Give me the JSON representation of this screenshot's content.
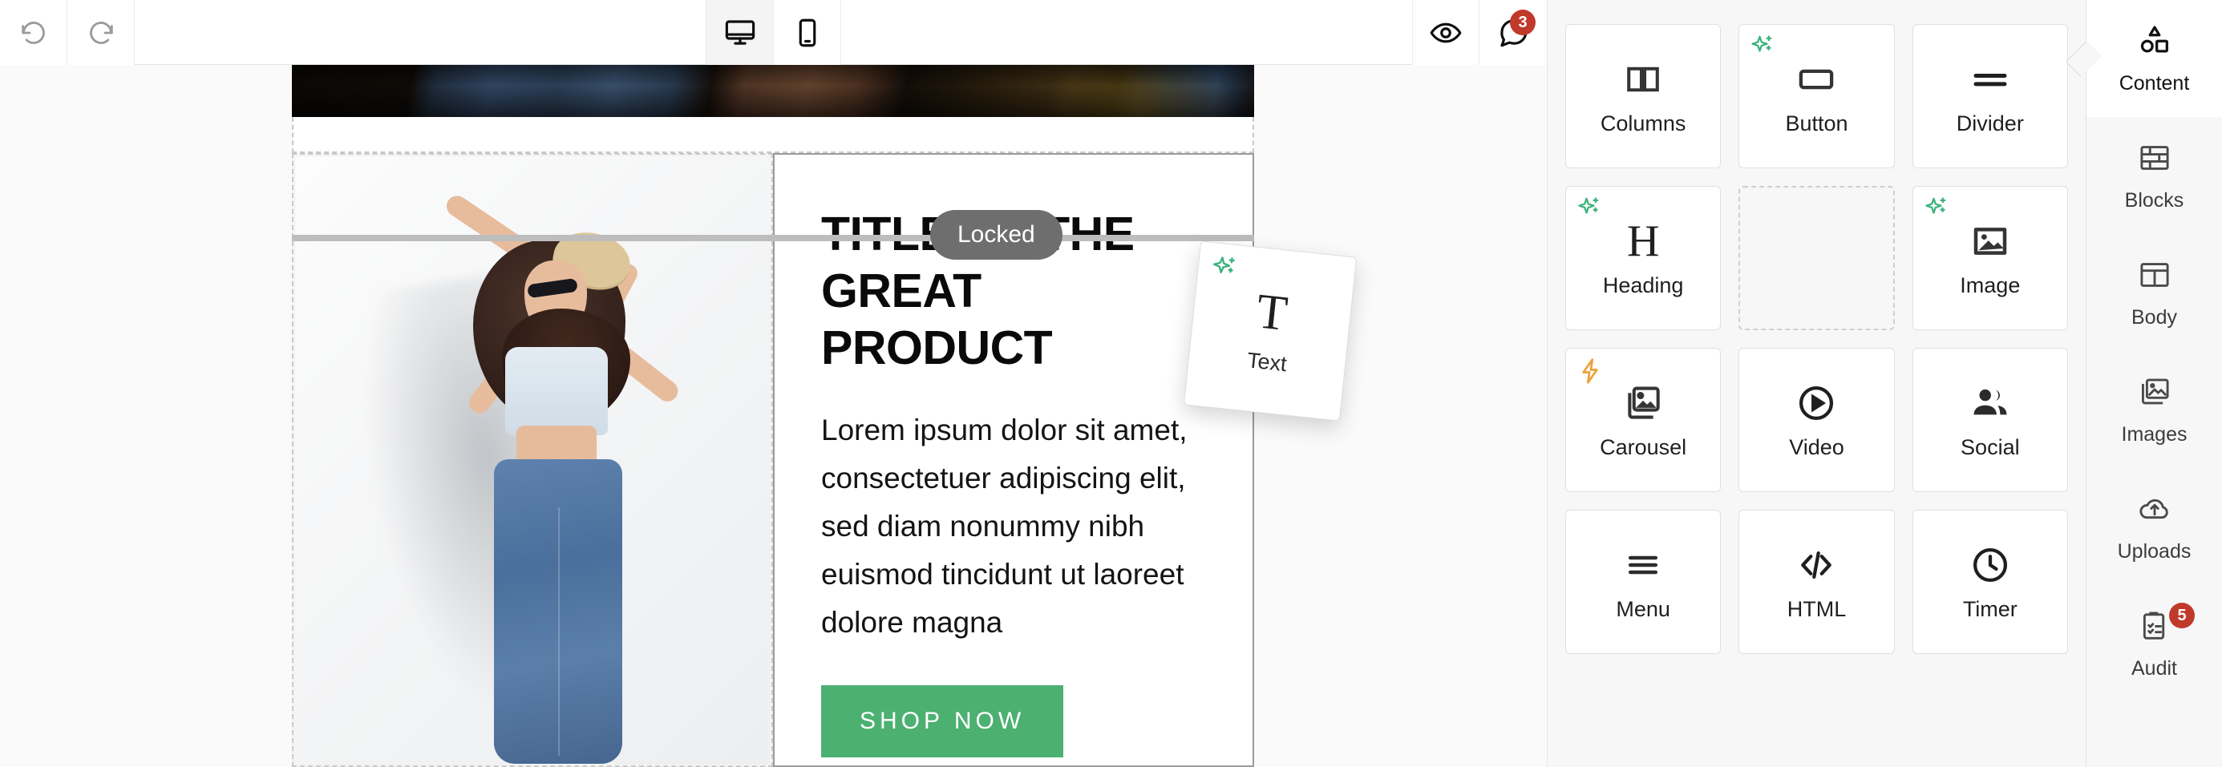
{
  "toolbar": {
    "undo": {
      "label": "Undo",
      "icon": "undo-icon",
      "disabled": true
    },
    "redo": {
      "label": "Redo",
      "icon": "redo-icon",
      "disabled": true
    },
    "desktop": {
      "label": "Desktop view",
      "icon": "desktop-icon",
      "active": true
    },
    "mobile": {
      "label": "Mobile view",
      "icon": "mobile-icon",
      "active": false
    },
    "preview": {
      "label": "Preview",
      "icon": "eye-icon"
    },
    "comments": {
      "label": "Comments",
      "icon": "comment-icon",
      "badge": "3"
    }
  },
  "canvas": {
    "banner": {
      "name": "hero-banner-image",
      "alt": "Dark photo of person in denim jacket"
    },
    "spacer": {
      "name": "spacer-row"
    },
    "drop_indicator": {
      "locked_label": "Locked"
    },
    "drag_ghost": {
      "label": "Text",
      "glyph": "T",
      "ai_badge": "sparkle-icon"
    },
    "left_column": {
      "alt": "Woman in white crop top, blue jeans, straw hat and sunglasses"
    },
    "right_column": {
      "title": "TITLE OF THE GREAT PRODUCT",
      "body": "Lorem ipsum dolor sit amet, consectetuer adipiscing elit, sed diam nonummy nibh euismod tincidunt ut laoreet dolore magna",
      "cta_label": "SHOP NOW",
      "cta_color": "#4cb071"
    }
  },
  "content_panel": {
    "tiles": [
      {
        "label": "Columns",
        "icon": "columns-icon",
        "badge": null,
        "empty": false
      },
      {
        "label": "Button",
        "icon": "button-icon",
        "badge": "ai",
        "empty": false
      },
      {
        "label": "Divider",
        "icon": "divider-icon",
        "badge": null,
        "empty": false
      },
      {
        "label": "Heading",
        "icon": "heading-icon",
        "badge": "ai",
        "empty": false
      },
      {
        "label": "",
        "icon": "",
        "badge": null,
        "empty": true
      },
      {
        "label": "Image",
        "icon": "image-icon",
        "badge": "ai",
        "empty": false
      },
      {
        "label": "Carousel",
        "icon": "carousel-icon",
        "badge": "bolt",
        "empty": false
      },
      {
        "label": "Video",
        "icon": "video-icon",
        "badge": null,
        "empty": false
      },
      {
        "label": "Social",
        "icon": "social-icon",
        "badge": null,
        "empty": false
      },
      {
        "label": "Menu",
        "icon": "menu-icon",
        "badge": null,
        "empty": false
      },
      {
        "label": "HTML",
        "icon": "html-icon",
        "badge": null,
        "empty": false
      },
      {
        "label": "Timer",
        "icon": "timer-icon",
        "badge": null,
        "empty": false
      }
    ]
  },
  "rail": {
    "items": [
      {
        "label": "Content",
        "icon": "shapes-icon",
        "active": true,
        "badge": null
      },
      {
        "label": "Blocks",
        "icon": "bricks-icon",
        "active": false,
        "badge": null
      },
      {
        "label": "Body",
        "icon": "layout-icon",
        "active": false,
        "badge": null
      },
      {
        "label": "Images",
        "icon": "images-icon",
        "active": false,
        "badge": null
      },
      {
        "label": "Uploads",
        "icon": "cloud-up-icon",
        "active": false,
        "badge": null
      },
      {
        "label": "Audit",
        "icon": "clipboard-icon",
        "active": false,
        "badge": "5"
      }
    ]
  },
  "colors": {
    "accent_green": "#4cb071",
    "badge_red": "#c0392b",
    "ai_green": "#3bb27d",
    "bolt_orange": "#eda13a",
    "locked_gray": "#6e6e6e"
  }
}
